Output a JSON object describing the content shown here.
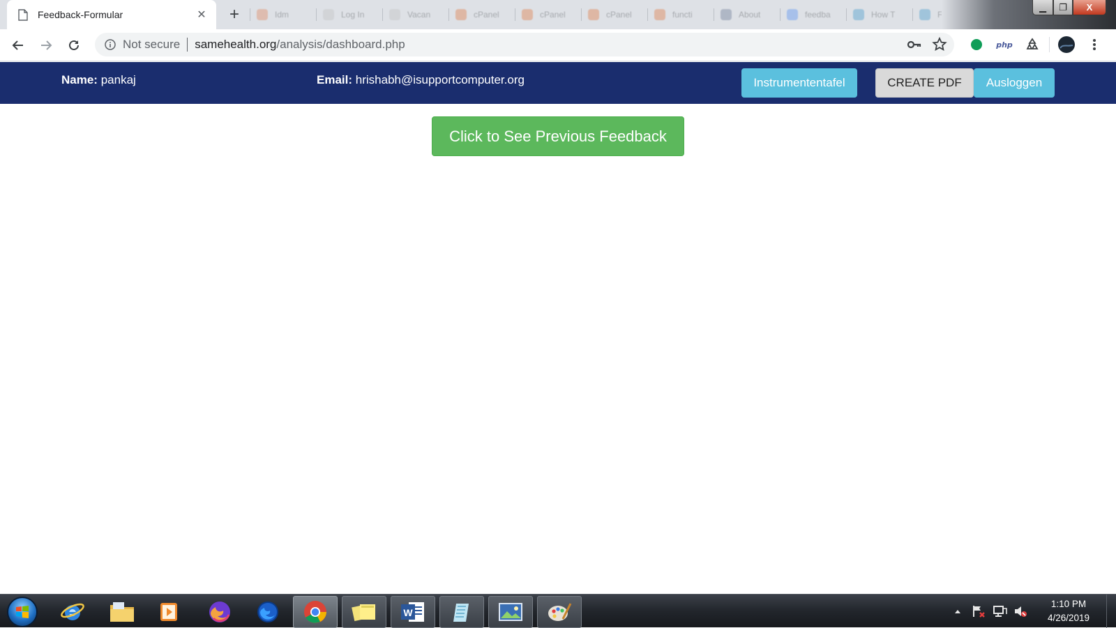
{
  "browser": {
    "active_tab": {
      "title": "Feedback-Formular",
      "close_glyph": "✕"
    },
    "new_tab_glyph": "+",
    "background_tabs": [
      {
        "label": "Idm",
        "color": "#e07a4a"
      },
      {
        "label": "Log In",
        "color": "#bdbdbd"
      },
      {
        "label": "Vacan",
        "color": "#bdbdbd"
      },
      {
        "label": "cPanel",
        "color": "#e06a2c"
      },
      {
        "label": "cPanel",
        "color": "#e06a2c"
      },
      {
        "label": "cPanel",
        "color": "#e06a2c"
      },
      {
        "label": "functi",
        "color": "#e06a2c"
      },
      {
        "label": "About",
        "color": "#5b6a8a"
      },
      {
        "label": "feedba",
        "color": "#4285f4"
      },
      {
        "label": "How T",
        "color": "#2e8fc7"
      },
      {
        "label": "Fo",
        "color": "#2e8fc7"
      }
    ],
    "window_controls": {
      "minimize": "▁",
      "maximize": "❐",
      "close": "X"
    },
    "address": {
      "security_label": "Not secure",
      "url_host": "samehealth.org",
      "url_path": "/analysis/dashboard.php"
    },
    "extensions": {
      "php_label": "php"
    }
  },
  "header": {
    "name_label": "Name:",
    "name_value": "pankaj",
    "email_label": "Email:",
    "email_value": "hrishabh@isupportcomputer.org",
    "buttons": {
      "dashboard": "Instrumententafel",
      "create_pdf": "CREATE PDF",
      "logout": "Ausloggen"
    },
    "colors": {
      "header_bg": "#1a2d6e",
      "info_btn": "#5bc0de",
      "default_btn": "#d9d9d9"
    }
  },
  "main": {
    "previous_feedback_button": "Click to See Previous Feedback",
    "button_color": "#5cb85c"
  },
  "taskbar": {
    "apps": [
      "internet-explorer",
      "file-explorer",
      "media-player",
      "firefox-nightly",
      "firefox",
      "chrome",
      "sticky-notes",
      "word",
      "notepad",
      "photo-viewer",
      "paint"
    ],
    "clock_time": "1:10 PM",
    "clock_date": "4/26/2019"
  }
}
